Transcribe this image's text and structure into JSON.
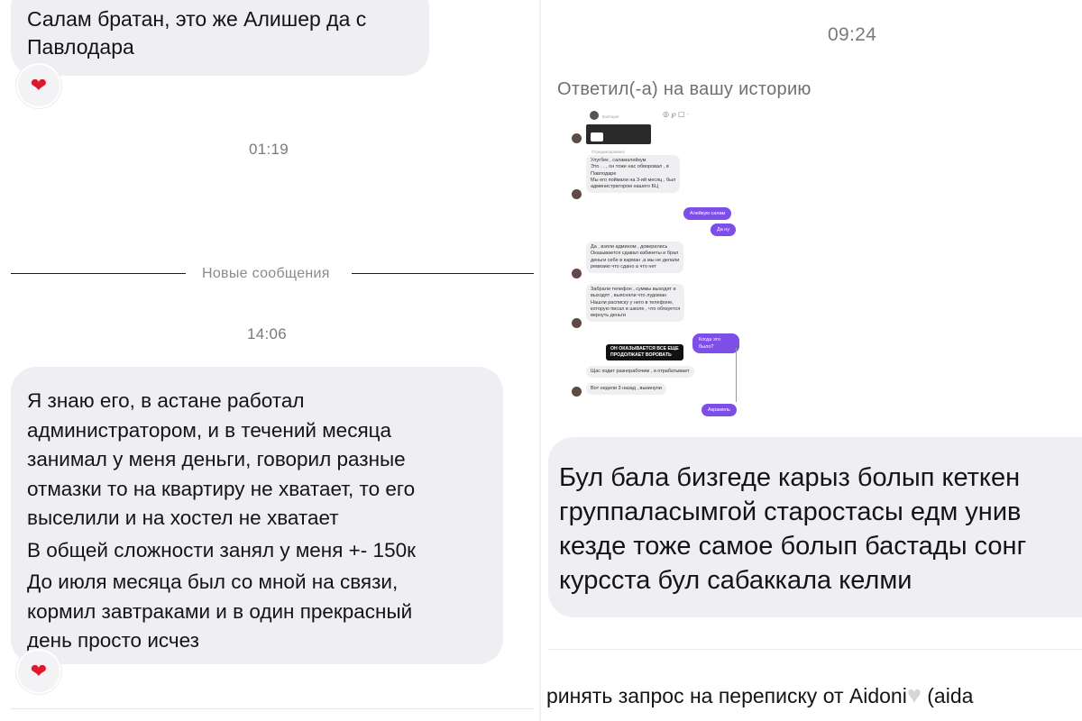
{
  "left": {
    "top_message": [
      "Салам братан, это же Алишер да с",
      "Павлодара"
    ],
    "reaction_icon": "heart",
    "time_1": "01:19",
    "separator_label": "Новые сообщения",
    "time_2": "14:06",
    "main_message": [
      "Я знаю его, в астане работал",
      "администратором, и в течений месяца",
      "занимал у меня деньги, говорил разные",
      "отмазки то на квартиру не хватает, то его",
      "выселили и на хостел не хватает",
      "В общей сложности занял у меня +- 150к",
      "До июля месяца был со мной на связи,",
      "кормил завтраками и в один прекрасный",
      "день просто исчез"
    ]
  },
  "right": {
    "time": "09:24",
    "story_reply_label": "Ответил(-а) на вашу историю",
    "story": {
      "header_user": "bochoyer",
      "forwarded_label": "Отредактировано",
      "msg1": [
        "Улугбек , саламалейкум",
        "Это .      .    , он тоже нас обворовал , в",
        "Павлодаре",
        "Мы его поймали на 3-ий месяц , был",
        "администратором нашего БЦ"
      ],
      "reply1": "Алейкум салам",
      "reply2": "Да ну",
      "msg2": [
        "Да , взяли админом , доверились",
        "Оказывается сдавал кабинеты и брал",
        "деньги себе в карман ,а мы не делали",
        "ревизию что сдано а что нет"
      ],
      "msg3": [
        "Забрали телефон , суммы выходят и",
        "выходят , выясняли что лудоман",
        "Нашли расписку у него в телефоне,",
        "которую писал в школе , что обязуется",
        "вернуть деньги"
      ],
      "reply3": "Когда это было?",
      "overlay_caption": [
        "ОН ОКАЗЫВАЕТСЯ ВСЕ ЕЩЕ",
        "ПРОДОЛЖАЕТ ВОРОВАТЬ"
      ],
      "msg4": "Щас ходит разнорабочим , и отрабатывает",
      "msg5": "Вот недели 3 назад , выкинули",
      "reply4": "Акрамель"
    },
    "reply_message": [
      "Бул бала бизгеде карыз болып кеткен",
      "группаласымгой старостасы едм унив",
      "кезде тоже самое болып бастады сонг",
      "курсста бул сабаккала келми"
    ],
    "request_text": "ринять запрос на переписку от Aidoni",
    "request_suffix": "(aida",
    "request_icon": "white-heart"
  }
}
